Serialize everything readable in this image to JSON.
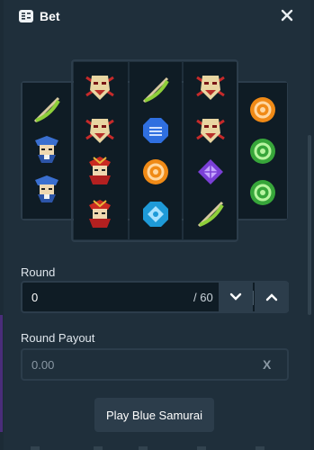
{
  "header": {
    "title": "Bet",
    "icon": "bet-slip-icon",
    "close_icon": "close-icon"
  },
  "reels": [
    {
      "symbols": [
        "bow",
        "blue-samurai",
        "blue-samurai"
      ]
    },
    {
      "symbols": [
        "samurai-mask",
        "samurai-mask",
        "red-samurai",
        "red-samurai"
      ]
    },
    {
      "symbols": [
        "bow",
        "blue-octagon",
        "orange-circle",
        "blue-badge"
      ]
    },
    {
      "symbols": [
        "samurai-mask",
        "samurai-mask",
        "purple-diamond",
        "bow"
      ]
    },
    {
      "symbols": [
        "orange-circle",
        "green-circle",
        "green-circle"
      ]
    }
  ],
  "round": {
    "label": "Round",
    "value": "0",
    "max": "/ 60",
    "down_icon": "chevron-down-icon",
    "up_icon": "chevron-up-icon"
  },
  "payout": {
    "label": "Round Payout",
    "value": "0.00",
    "clear": "X"
  },
  "play_button": {
    "label": "Play Blue Samurai"
  },
  "colors": {
    "panel": "#1f2f3b",
    "reel": "#0f1c25",
    "button": "#2c3d4b",
    "accent_purple": "#4a2d7a"
  }
}
